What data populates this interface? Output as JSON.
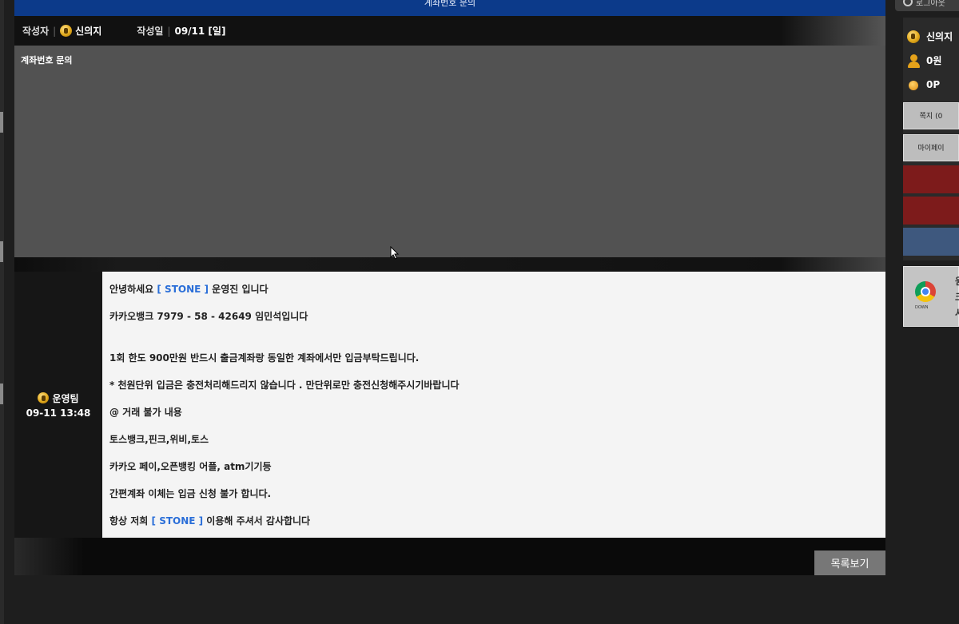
{
  "title_bar": {
    "title": "계좌번호 문의"
  },
  "post": {
    "author_label": "작성자",
    "author_name": "신의지",
    "date_label": "작성일",
    "date_value": "09/11 [일]",
    "subject": "계좌번호 문의"
  },
  "reply": {
    "author": "운영팀",
    "datetime": "09-11 13:48",
    "lines": {
      "l1_pre": "안녕하세요 ",
      "l1_brand": "[ STONE ]",
      "l1_post": " 운영진 입니다",
      "l2": "카카오뱅크 7979 - 58 - 42649 임민석입니다",
      "l3": "1회 한도 900만원 반드시 출금계좌랑 동일한 계좌에서만 입금부탁드립니다.",
      "l4": "* 천원단위 입금은 충전처리해드리지 않습니다 . 만단위로만 충전신청해주시기바랍니다",
      "l5": "@ 거래 불가 내용",
      "l6": "토스뱅크,핀크,위비,토스",
      "l7": "카카오 페이,오픈뱅킹 어플, atm기기등",
      "l8": "간편계좌 이체는 입금 신청 불가 합니다.",
      "l9_pre": "항상 저희 ",
      "l9_brand": "[ STONE ]",
      "l9_post": " 이용해 주셔서 감사합니다"
    }
  },
  "buttons": {
    "list_view": "목록보기"
  },
  "sidebar": {
    "logout_partial": "로그아웃",
    "username": "신의지",
    "money": "0원",
    "points": "0P",
    "btn_message": "쪽지 (0",
    "btn_mypage": "마이페이",
    "chrome_down": "DOWN",
    "chrome_text_1": "원",
    "chrome_text_2": "크",
    "chrome_text_3": "사"
  },
  "colors": {
    "title_bar": "#0c3a8a",
    "brand_highlight": "#2a6ed8",
    "sidebar_red": "#7d1b1b",
    "sidebar_blue": "#3e587e"
  }
}
